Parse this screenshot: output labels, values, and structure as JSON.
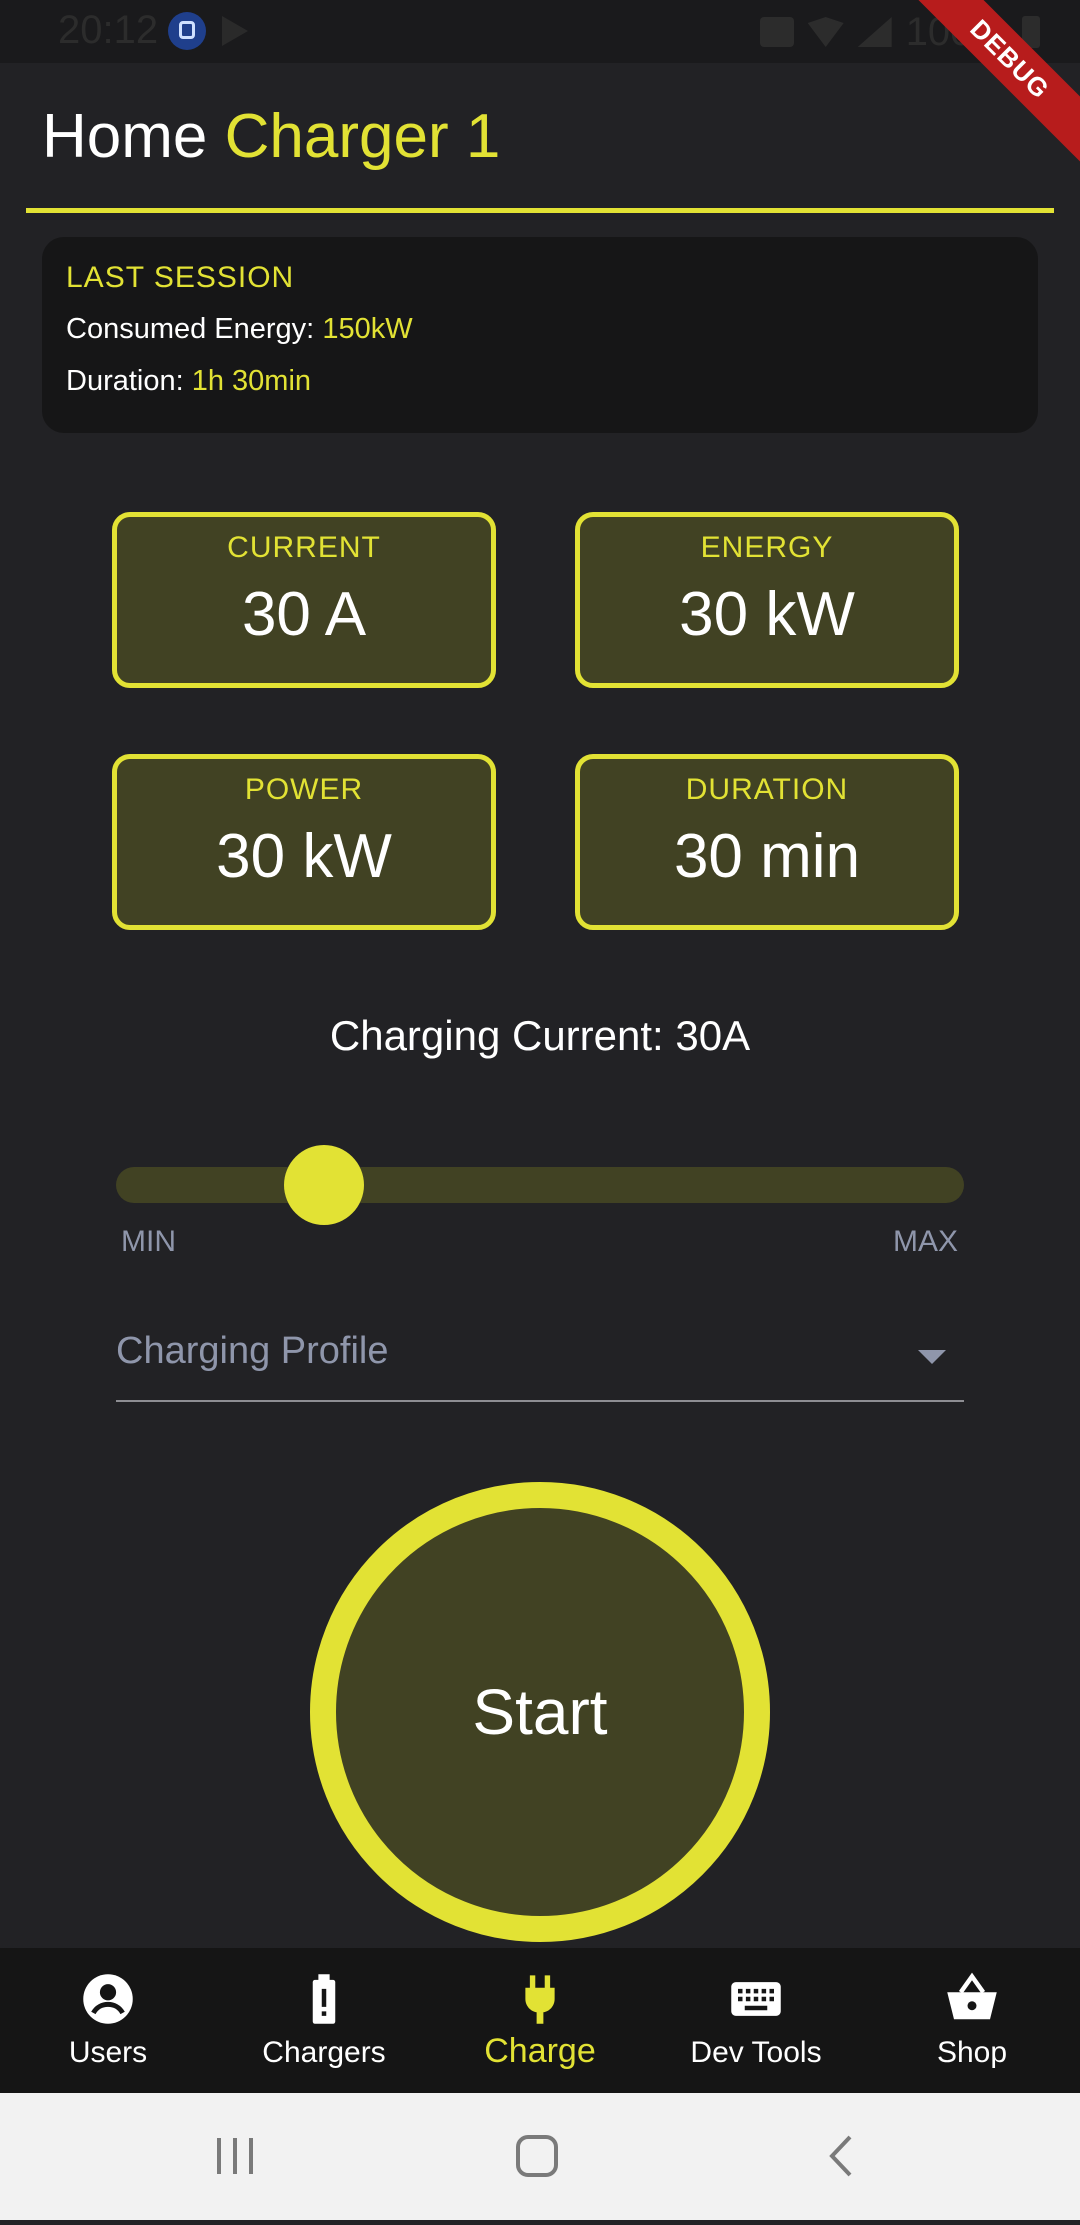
{
  "status_bar": {
    "time": "20:12",
    "battery_text": "100%"
  },
  "debug_banner": "DEBUG",
  "app_bar": {
    "title_prefix": "Home",
    "title_accent": "Charger 1"
  },
  "last_session": {
    "heading": "LAST SESSION",
    "energy_label": "Consumed Energy:",
    "energy_value": "150kW",
    "duration_label": "Duration:",
    "duration_value": "1h 30min"
  },
  "stats": [
    {
      "label": "CURRENT",
      "value": "30 A"
    },
    {
      "label": "ENERGY",
      "value": "30 kW"
    },
    {
      "label": "POWER",
      "value": "30 kW"
    },
    {
      "label": "DURATION",
      "value": "30 min"
    }
  ],
  "charging_current_text": "Charging Current: 30A",
  "slider": {
    "min_label": "MIN",
    "max_label": "MAX",
    "level": 0.3
  },
  "charging_profile": {
    "placeholder": "Charging Profile"
  },
  "start_button": "Start",
  "colors": {
    "accent": "#e2e234",
    "accent_dim": "#414223",
    "background": "#222225",
    "nav_bg": "#151515"
  },
  "bottom_nav": [
    {
      "label": "Users",
      "icon": "account-circle-icon",
      "active": false
    },
    {
      "label": "Chargers",
      "icon": "battery-alert-icon",
      "active": false
    },
    {
      "label": "Charge",
      "icon": "power-plug-icon",
      "active": true
    },
    {
      "label": "Dev Tools",
      "icon": "keyboard-icon",
      "active": false
    },
    {
      "label": "Shop",
      "icon": "shopping-basket-icon",
      "active": false
    }
  ],
  "system_nav": {
    "recent_icon": "recent-apps-icon",
    "home_icon": "home-icon",
    "back_icon": "back-icon"
  }
}
